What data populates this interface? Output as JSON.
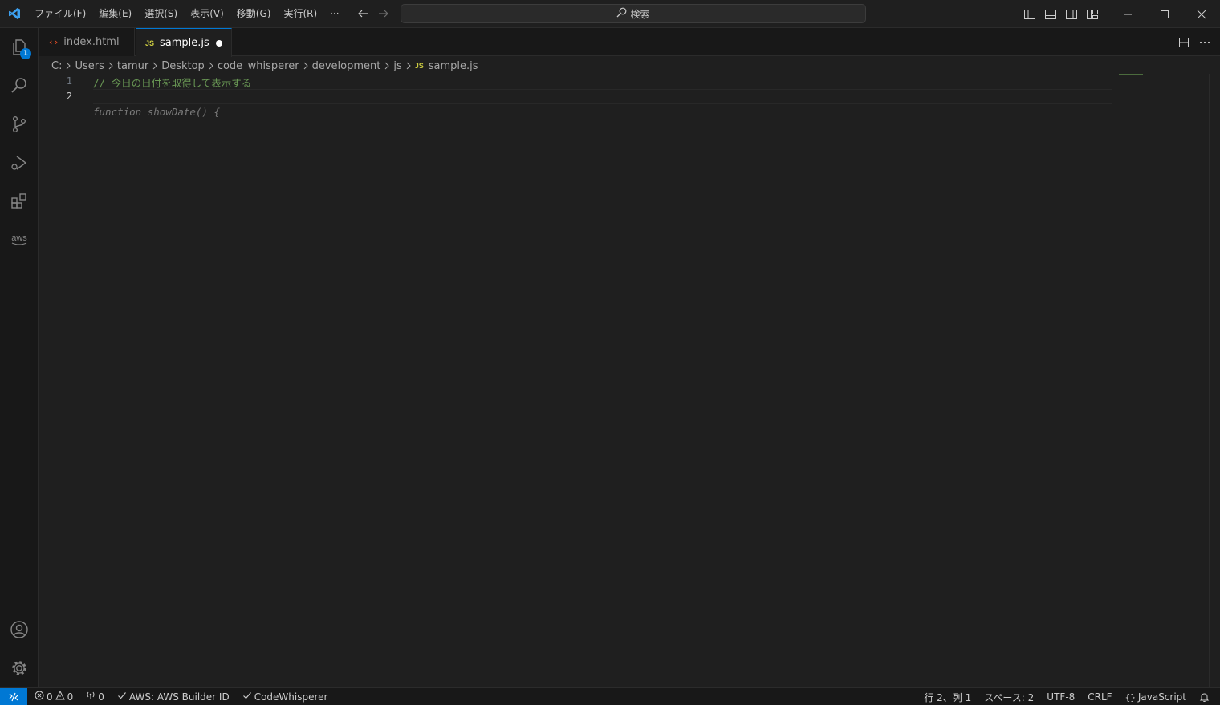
{
  "menu": {
    "items": [
      "ファイル(F)",
      "編集(E)",
      "選択(S)",
      "表示(V)",
      "移動(G)",
      "実行(R)"
    ],
    "more_label": "···"
  },
  "search": {
    "label": "検索"
  },
  "activity": {
    "explorer_badge": "1"
  },
  "tabs": [
    {
      "label": "index.html",
      "icon": "html-icon"
    },
    {
      "label": "sample.js",
      "icon": "js-icon",
      "icon_text": "JS",
      "dirty": true
    }
  ],
  "breadcrumb": {
    "parts": [
      "C:",
      "Users",
      "tamur",
      "Desktop",
      "code_whisperer",
      "development",
      "js"
    ],
    "file_icon": "JS",
    "file": "sample.js"
  },
  "editor": {
    "line_numbers": [
      "1",
      "2"
    ],
    "line1": "// 今日の日付を取得して表示する",
    "ghost": "function showDate() {"
  },
  "status": {
    "errors": "0",
    "warnings": "0",
    "ports": "0",
    "aws": "AWS: AWS Builder ID",
    "codewhisperer": "CodeWhisperer",
    "position": "行 2、列 1",
    "spaces": "スペース: 2",
    "encoding": "UTF-8",
    "eol": "CRLF",
    "language": "JavaScript"
  },
  "colors": {
    "accent": "#0078d4",
    "comment": "#6a9955",
    "js_icon": "#cbcb41",
    "html_icon": "#e44d26"
  }
}
